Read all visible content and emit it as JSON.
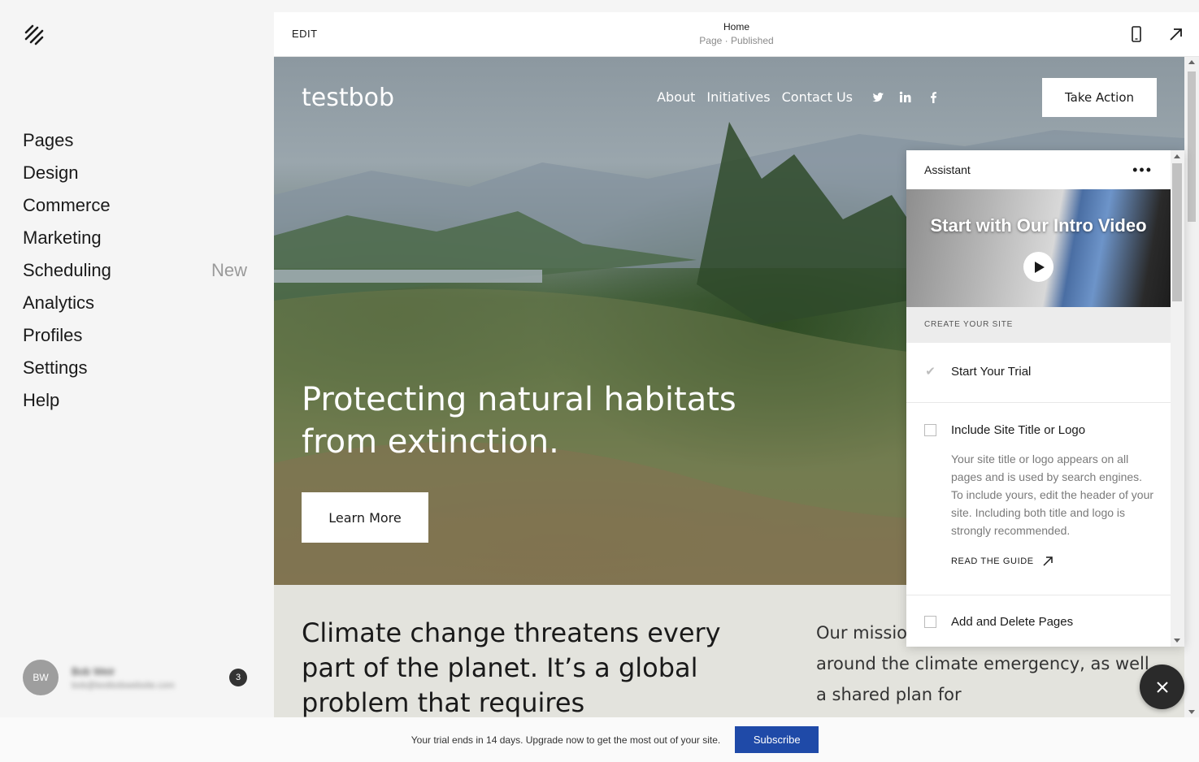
{
  "sidebar": {
    "items": [
      {
        "label": "Pages"
      },
      {
        "label": "Design"
      },
      {
        "label": "Commerce"
      },
      {
        "label": "Marketing"
      },
      {
        "label": "Scheduling",
        "badge": "New"
      },
      {
        "label": "Analytics"
      },
      {
        "label": "Profiles"
      },
      {
        "label": "Settings"
      },
      {
        "label": "Help"
      }
    ],
    "account": {
      "initials": "BW",
      "name": "Bob Weir",
      "email": "bob@testbobwebsite.com",
      "notifications": "3"
    }
  },
  "topbar": {
    "edit_label": "EDIT",
    "page_title": "Home",
    "page_status": "Page · Published"
  },
  "site": {
    "title": "testbob",
    "nav": [
      "About",
      "Initiatives",
      "Contact Us"
    ],
    "cta": "Take Action",
    "headline": "Protecting natural habitats from extinction.",
    "learn_more": "Learn More",
    "lower_left": "Climate change threatens every part of the planet. It’s a global problem that requires",
    "lower_right": "Our mission is to build consensus around the climate emergency, as well a shared plan for"
  },
  "assistant": {
    "title": "Assistant",
    "video_title": "Start with Our Intro Video",
    "section_label": "CREATE YOUR SITE",
    "steps": [
      {
        "title": "Start Your Trial",
        "checked": true
      },
      {
        "title": "Include Site Title or Logo",
        "checked": false,
        "description": "Your site title or logo appears on all pages and is used by search engines. To include yours, edit the header of your site. Including both title and logo is strongly recommended.",
        "guide": "READ THE GUIDE"
      },
      {
        "title": "Add and Delete Pages",
        "checked": false
      }
    ]
  },
  "banner": {
    "text": "Your trial ends in 14 days. Upgrade now to get the most out of your site.",
    "subscribe": "Subscribe"
  },
  "colors": {
    "accent": "#1f4aa8",
    "fab": "#2a2a2a"
  }
}
